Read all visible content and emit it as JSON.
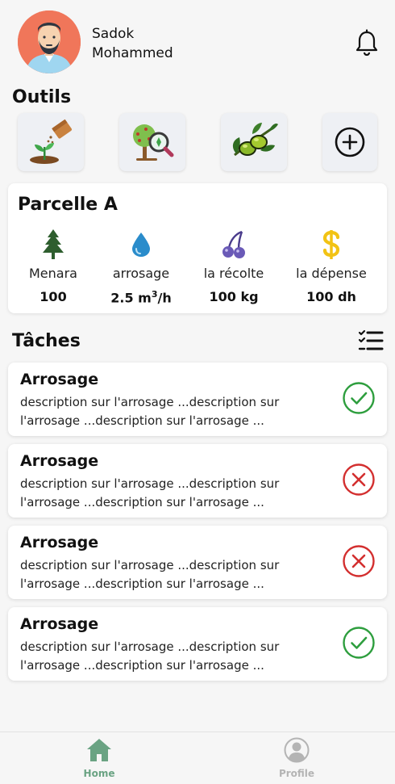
{
  "header": {
    "user_name": "Sadok Mohammed",
    "avatar_icon": "user-avatar-icon",
    "notification_icon": "bell-icon"
  },
  "tools": {
    "title": "Outils",
    "items": [
      {
        "icon": "seedling-planting-icon"
      },
      {
        "icon": "tree-inspection-icon"
      },
      {
        "icon": "olive-branch-icon"
      },
      {
        "icon": "add-circle-icon"
      }
    ]
  },
  "parcelle": {
    "title": "Parcelle A",
    "stats": [
      {
        "icon": "tree-icon",
        "label": "Menara",
        "value": "100"
      },
      {
        "icon": "water-drop-icon",
        "label": "arrosage",
        "value": "2.5 m",
        "value_sup": "3",
        "value_suffix": "/h"
      },
      {
        "icon": "cherries-icon",
        "label": "la récolte",
        "value": "100 kg"
      },
      {
        "icon": "dollar-icon",
        "label": "la dépense",
        "value": "100 dh"
      }
    ]
  },
  "tasks": {
    "title": "Tâches",
    "list_icon": "checklist-icon",
    "items": [
      {
        "title": "Arrosage",
        "description": "description sur l'arrosage ...description sur l'arrosage ...description sur l'arrosage ...",
        "status": "done"
      },
      {
        "title": "Arrosage",
        "description": "description sur l'arrosage ...description sur l'arrosage ...description sur l'arrosage ...",
        "status": "cancelled"
      },
      {
        "title": "Arrosage",
        "description": "description sur l'arrosage ...description sur l'arrosage ...description sur l'arrosage ...",
        "status": "cancelled"
      },
      {
        "title": "Arrosage",
        "description": "description sur l'arrosage ...description sur l'arrosage ...description sur l'arrosage ...",
        "status": "done"
      }
    ]
  },
  "nav": {
    "home_label": "Home",
    "profile_label": "Profile",
    "active": "home"
  },
  "colors": {
    "success": "#2e9e3e",
    "danger": "#d32f2f",
    "nav_active": "#6aa383",
    "nav_inactive": "#b4b4b4",
    "avatar_bg": "#f0765a"
  }
}
